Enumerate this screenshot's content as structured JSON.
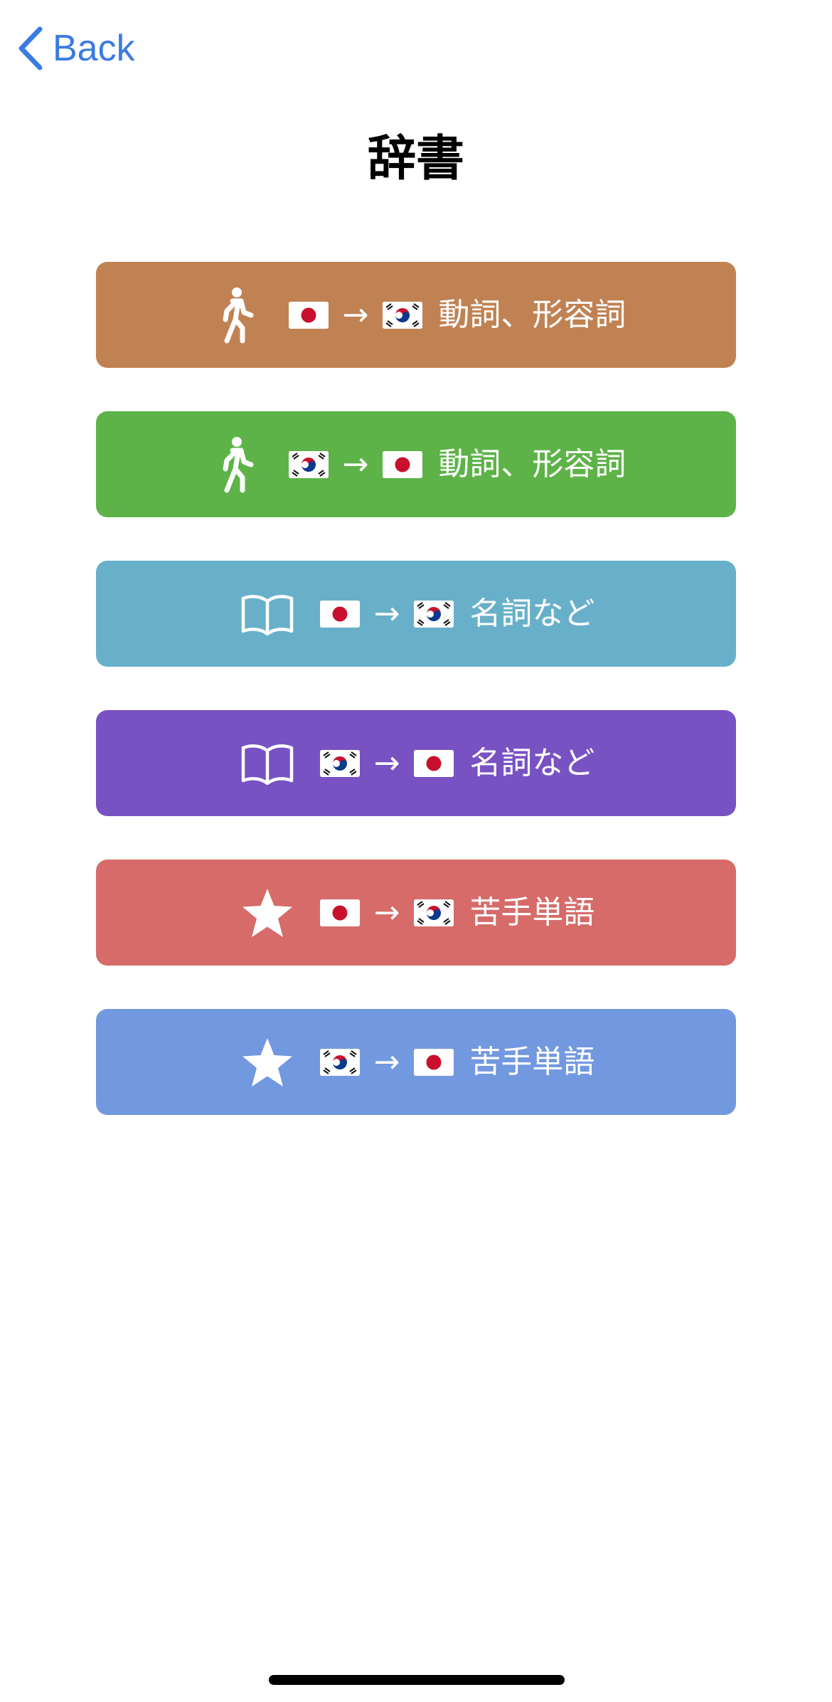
{
  "nav": {
    "back_label": "Back",
    "accent_color": "#3a7be0"
  },
  "page": {
    "title": "辞書"
  },
  "menu": {
    "items": [
      {
        "icon": "walking-person-icon",
        "from": "japan-flag",
        "to": "korea-flag",
        "arrow": "→",
        "label": "動詞、形容詞",
        "color": "#c08253"
      },
      {
        "icon": "walking-person-icon",
        "from": "korea-flag",
        "to": "japan-flag",
        "arrow": "→",
        "label": "動詞、形容詞",
        "color": "#5db347"
      },
      {
        "icon": "open-book-icon",
        "from": "japan-flag",
        "to": "korea-flag",
        "arrow": "→",
        "label": "名詞など",
        "color": "#68b0c9"
      },
      {
        "icon": "open-book-icon",
        "from": "korea-flag",
        "to": "japan-flag",
        "arrow": "→",
        "label": "名詞など",
        "color": "#7851c3"
      },
      {
        "icon": "star-icon",
        "from": "japan-flag",
        "to": "korea-flag",
        "arrow": "→",
        "label": "苦手単語",
        "color": "#d66b69"
      },
      {
        "icon": "star-icon",
        "from": "korea-flag",
        "to": "japan-flag",
        "arrow": "→",
        "label": "苦手単語",
        "color": "#7298df"
      }
    ]
  }
}
